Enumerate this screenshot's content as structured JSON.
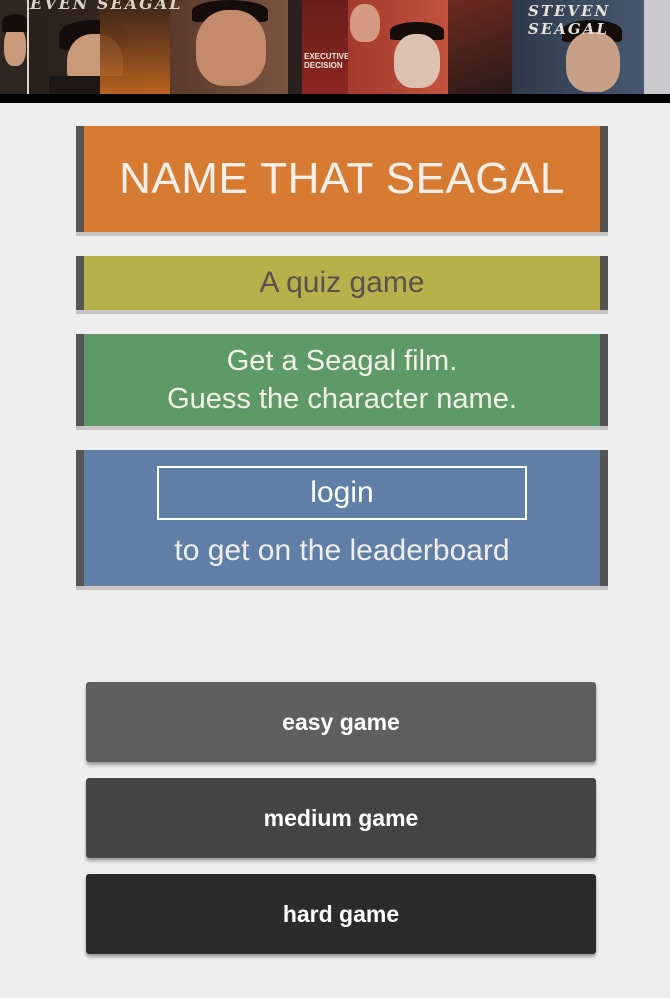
{
  "banner": {
    "text_left": "EVEN SEAGAL",
    "text_right": "STEVEN SEAGAL",
    "poster_text": "EXECUTIVE DECISION"
  },
  "title": "NAME THAT SEAGAL",
  "subtitle": "A quiz game",
  "description": {
    "line1": "Get a Seagal film.",
    "line2": "Guess the character name."
  },
  "login": {
    "button_label": "login",
    "note": "to get on the leaderboard"
  },
  "games": {
    "easy": "easy game",
    "medium": "medium game",
    "hard": "hard game"
  },
  "colors": {
    "title_bg": "#d77b33",
    "subtitle_bg": "#b5b14b",
    "description_bg": "#5d9a67",
    "login_bg": "#5f7fa7"
  }
}
